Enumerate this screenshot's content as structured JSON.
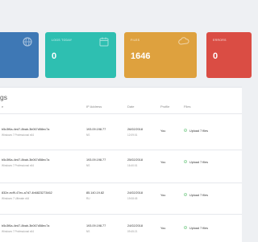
{
  "stats": [
    {
      "label": "",
      "value": "",
      "color": "#3e78b5",
      "icon": "globe-icon"
    },
    {
      "label": "LOGS TODAY",
      "value": "0",
      "color": "#2ebfb1",
      "icon": "calendar-icon"
    },
    {
      "label": "FILES",
      "value": "1646",
      "color": "#dea13e",
      "icon": "cloud-icon"
    },
    {
      "label": "ERRORS",
      "value": "0",
      "color": "#da4d44",
      "icon": "warning-icon"
    }
  ],
  "panel": {
    "title": "gs"
  },
  "columns": {
    "name": "e",
    "ip": "IP Address",
    "date": "Date",
    "profile": "Profile",
    "files": "Files"
  },
  "rows": [
    {
      "name": "b5c3f6a-4ed7-8bab-3b067d58ec7a",
      "os": "Windows 7 Professional x64",
      "ip": "193.09.198.77",
      "ip_sub": "NS",
      "date": "26/02/2018",
      "time": "12:09:01",
      "profile": "You",
      "files": "Upload 7 files"
    },
    {
      "name": "b5c3f6a-4ed7-8bab-3b067d58ec7a",
      "os": "Windows 7 Professional x64",
      "ip": "193.09.198.77",
      "ip_sub": "NS",
      "date": "25/02/2018",
      "time": "16:40:01",
      "profile": "You",
      "files": "Upload 7 files"
    },
    {
      "name": "832e-ecf9-47ec-a7d7-4b6823273462",
      "os": "Windows 7 Ultimate x64",
      "ip": "85.140.19.82",
      "ip_sub": "RU",
      "date": "24/02/2018",
      "time": "19:08:45",
      "profile": "You",
      "files": "Upload 7 files"
    },
    {
      "name": "b5c3f6a-4ed7-8bab-3b067d58ec7a",
      "os": "Windows 7 Professional x64",
      "ip": "193.09.198.77",
      "ip_sub": "NS",
      "date": "24/02/2018",
      "time": "09:45:21",
      "profile": "You",
      "files": "Upload 7 files"
    }
  ]
}
